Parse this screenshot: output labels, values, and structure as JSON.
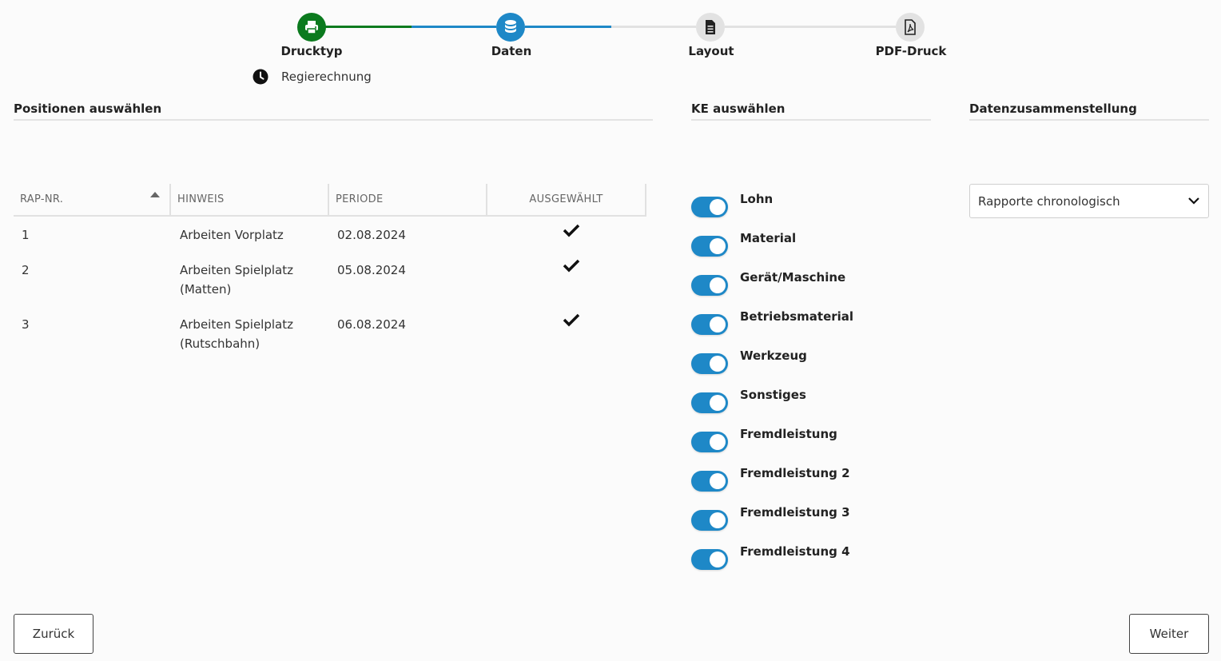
{
  "stepper": {
    "steps": [
      {
        "label": "Drucktyp",
        "icon": "printer-icon",
        "state": "done"
      },
      {
        "label": "Daten",
        "icon": "database-icon",
        "state": "active"
      },
      {
        "label": "Layout",
        "icon": "document-icon",
        "state": "pending"
      },
      {
        "label": "PDF-Druck",
        "icon": "pdf-file-icon",
        "state": "pending"
      }
    ],
    "selected_type": "Regierechnung",
    "colors": {
      "done": "#0b7a1e",
      "active": "#1e88c7",
      "pending": "#e2e2e2"
    }
  },
  "sections": {
    "positions": "Positionen auswählen",
    "ke": "KE auswählen",
    "compilation": "Datenzusammenstellung"
  },
  "table": {
    "columns": [
      "RAP-NR.",
      "HINWEIS",
      "PERIODE",
      "AUSGEWÄHLT"
    ],
    "sort_column": "RAP-NR.",
    "sort_direction": "ascending",
    "rows": [
      {
        "nr": "1",
        "hinweis": "Arbeiten Vorplatz",
        "periode": "02.08.2024",
        "selected": true
      },
      {
        "nr": "2",
        "hinweis": "Arbeiten Spielplatz (Matten)",
        "periode": "05.08.2024",
        "selected": true
      },
      {
        "nr": "3",
        "hinweis": "Arbeiten Spielplatz (Rutschbahn)",
        "periode": "06.08.2024",
        "selected": true
      }
    ]
  },
  "ke_toggles": [
    {
      "label": "Lohn",
      "on": true
    },
    {
      "label": "Material",
      "on": true
    },
    {
      "label": "Gerät/Maschine",
      "on": true
    },
    {
      "label": "Betriebsmaterial",
      "on": true
    },
    {
      "label": "Werkzeug",
      "on": true
    },
    {
      "label": "Sonstiges",
      "on": true
    },
    {
      "label": "Fremdleistung",
      "on": true
    },
    {
      "label": "Fremdleistung 2",
      "on": true
    },
    {
      "label": "Fremdleistung 3",
      "on": true
    },
    {
      "label": "Fremdleistung 4",
      "on": true
    }
  ],
  "compilation_select": {
    "value": "Rapporte chronologisch"
  },
  "buttons": {
    "back": "Zurück",
    "next": "Weiter"
  }
}
